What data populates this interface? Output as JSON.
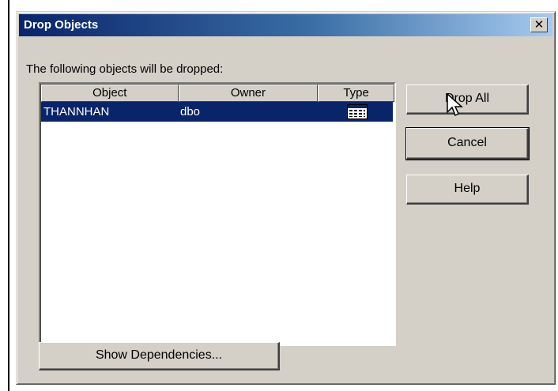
{
  "window": {
    "title": "Drop Objects",
    "close_glyph": "✕"
  },
  "caption": "The following objects will be dropped:",
  "list": {
    "columns": [
      "Object",
      "Owner",
      "Type"
    ],
    "rows": [
      {
        "object": "THANNHAN",
        "owner": "dbo",
        "type_icon": "table-icon",
        "selected": true
      }
    ]
  },
  "buttons": {
    "drop_all": "Drop All",
    "cancel": "Cancel",
    "help": "Help",
    "show_dependencies": "Show Dependencies..."
  },
  "colors": {
    "titlebar_start": "#0a246a",
    "titlebar_end": "#a6caf0",
    "selection": "#0a246a",
    "face": "#d4d0c8"
  }
}
